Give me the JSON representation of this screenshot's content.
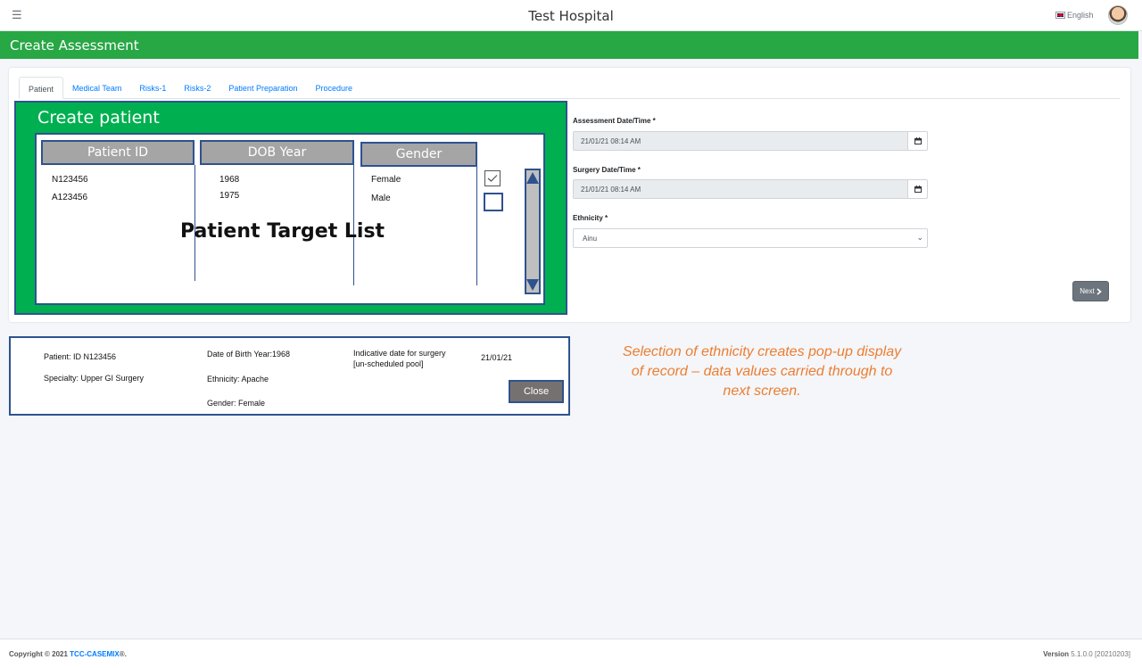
{
  "header": {
    "menu_icon": "hamburger-icon",
    "title": "Test Hospital",
    "language": "English"
  },
  "page": {
    "title": "Create Assessment"
  },
  "tabs": [
    {
      "label": "Patient",
      "active": true
    },
    {
      "label": "Medical Team"
    },
    {
      "label": "Risks-1"
    },
    {
      "label": "Risks-2"
    },
    {
      "label": "Patient Preparation"
    },
    {
      "label": "Procedure"
    }
  ],
  "create_patient": {
    "title": "Create patient",
    "columns": [
      "Patient ID",
      "DOB Year",
      "Gender"
    ],
    "rows": [
      {
        "id": "N123456",
        "dob": "1968",
        "gender": "Female",
        "checked": true
      },
      {
        "id": "A123456",
        "dob": "1975",
        "gender": "Male",
        "checked": false
      }
    ],
    "overlay_label": "Patient Target List"
  },
  "form": {
    "assessment_label": "Assessment Date/Time *",
    "assessment_value": "21/01/21 08:14 AM",
    "surgery_label": "Surgery Date/Time *",
    "surgery_value": "21/01/21 08:14 AM",
    "ethnicity_label": "Ethnicity *",
    "ethnicity_value": "Ainu",
    "next_label": "Next"
  },
  "popup": {
    "patient": "Patient: ID N123456",
    "specialty": "Specialty: Upper GI Surgery",
    "dob": "Date of Birth Year:1968",
    "ethnicity": "Ethnicity: Apache",
    "gender": "Gender: Female",
    "indicative_label_1": "Indicative date for surgery",
    "indicative_label_2": "[un-scheduled pool]",
    "indicative_date": "21/01/21",
    "close_label": "Close"
  },
  "annotation": {
    "line1": "Selection of ethnicity creates pop-up display",
    "line2": "of record – data values carried through to",
    "line3": "next screen."
  },
  "footer": {
    "copyright": "Copyright © 2021",
    "brand": "TCC-CASEMIX",
    "brand_suffix": "®.",
    "version_label": "Version",
    "version_value": "5.1.0.0 [20210203]"
  },
  "colors": {
    "primary_green": "#28a745",
    "panel_green": "#00b050",
    "outline_blue": "#2f528f",
    "annotation_orange": "#ed7d31",
    "link_blue": "#007bff"
  }
}
